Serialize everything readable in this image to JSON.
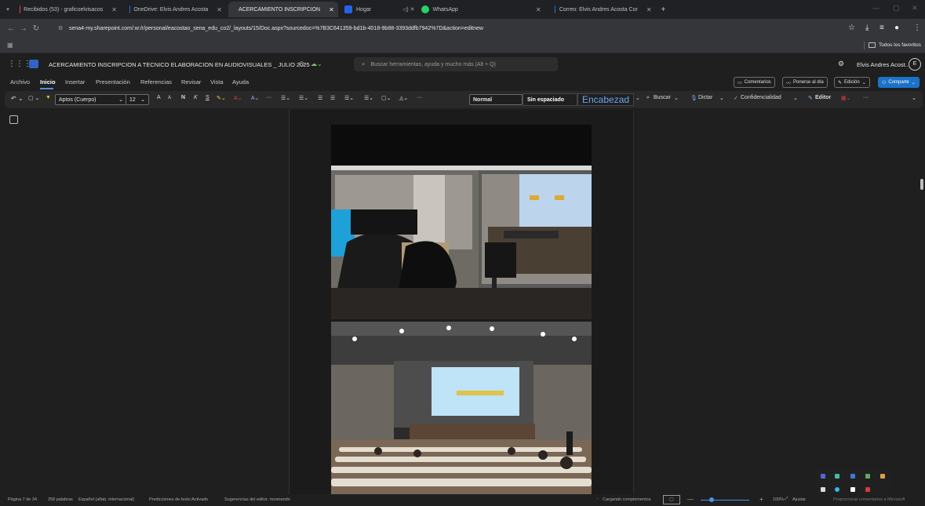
{
  "browser": {
    "tabs": [
      {
        "title": "Recibidos (53) - graficoelvisacos",
        "favicon": "gmail-icon",
        "active": false
      },
      {
        "title": "OneDrive: Elvis Andres Acosta",
        "favicon": "onedrive-icon",
        "active": false
      },
      {
        "title": "ACERCAMIENTO INSCRIPCION",
        "favicon": "word-icon",
        "active": true
      },
      {
        "title": "Hogar",
        "favicon": "home-icon",
        "active": false
      },
      {
        "title": "WhatsApp",
        "favicon": "whatsapp-icon",
        "active": false
      },
      {
        "title": "Correo: Elvis Andres Acosta Cor",
        "favicon": "outlook-icon",
        "active": false
      }
    ],
    "new_tab": "+",
    "url": "sena4-my.sharepoint.com/:w:/r/personal/eacostao_sena_edu_co2/_layouts/15/Doc.aspx?sourcedoc=%7B3C641359-bd1b-4018-9b88-3393ddfb7942%7D&action=editnew",
    "favorites_label": "Todos los favoritos"
  },
  "office": {
    "doc_title": "ACERCAMIENTO INSCRIPCION A TECNICO ELABORACION EN AUDIOVISUALES _ JULIO 2025",
    "search_placeholder": "Buscar herramientas, ayuda y mucho más (Alt + Q)",
    "user_name": "Elvis Andres Acost...",
    "user_initial": "E"
  },
  "menu": {
    "tabs": [
      "Archivo",
      "Inicio",
      "Insertar",
      "Presentación",
      "Referencias",
      "Revisar",
      "Vista",
      "Ayuda"
    ],
    "selected": "Inicio",
    "comments": "Comentarios",
    "catch_up": "Ponerse al día",
    "editing": "Edición",
    "share": "Comparte"
  },
  "ribbon": {
    "font": "Aptos (Cuerpo)",
    "font_size": "12",
    "grow_font": "A",
    "shrink_font": "A",
    "bold": "N",
    "italic": "K",
    "underline": "S",
    "style_normal": "Normal",
    "style_nospacing": "Sin espaciado",
    "style_heading": "Encabezad",
    "find": "Buscar",
    "dictate": "Dictar",
    "sensitivity": "Confidencialidad",
    "editor": "Editor",
    "more": "···"
  },
  "status": {
    "page": "Página 7 de 34",
    "words": "258 palabras",
    "language": "Español (alfab. internacional)",
    "predictions": "Predicciones de texto:Activado",
    "editor_suggestions": "Sugerencias del editor: mostrando",
    "loading": "Cargando complementos",
    "zoom": "100%",
    "fit": "Ajustar",
    "feedback": "Proporcionar comentarios a Microsoft"
  },
  "colors": {
    "accent": "#1a73c8",
    "background": "#1f1f1f",
    "ribbon": "#292929"
  }
}
